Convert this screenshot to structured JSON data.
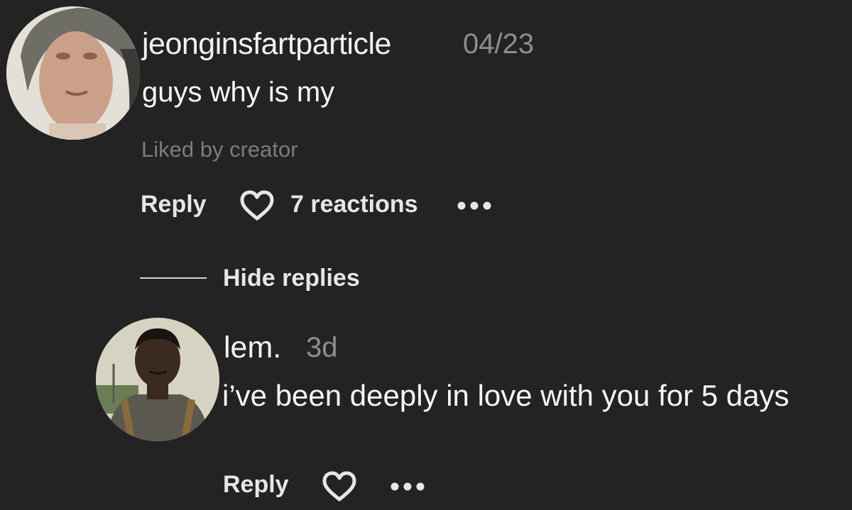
{
  "comments": [
    {
      "username": "jeonginsfartparticle",
      "time": "04/23",
      "text": "guys why is my",
      "liked_by": "Liked by creator",
      "reply_label": "Reply",
      "reactions": "7 reactions",
      "icons": {
        "reply_heart": "heart-outline-icon",
        "more": "more-dots-icon"
      }
    },
    {
      "username": "lem.",
      "time": "3d",
      "text": "i’ve been deeply in love with you for 5 days",
      "reply_label": "Reply",
      "icons": {
        "reply_heart": "heart-outline-icon",
        "more": "more-dots-icon"
      }
    }
  ],
  "thread": {
    "hide_replies_label": "Hide replies"
  },
  "colors": {
    "background": "#232323",
    "primary_text": "#f2f2f2",
    "secondary_text": "#8e8e8e",
    "muted_text": "#7c7c7c"
  }
}
